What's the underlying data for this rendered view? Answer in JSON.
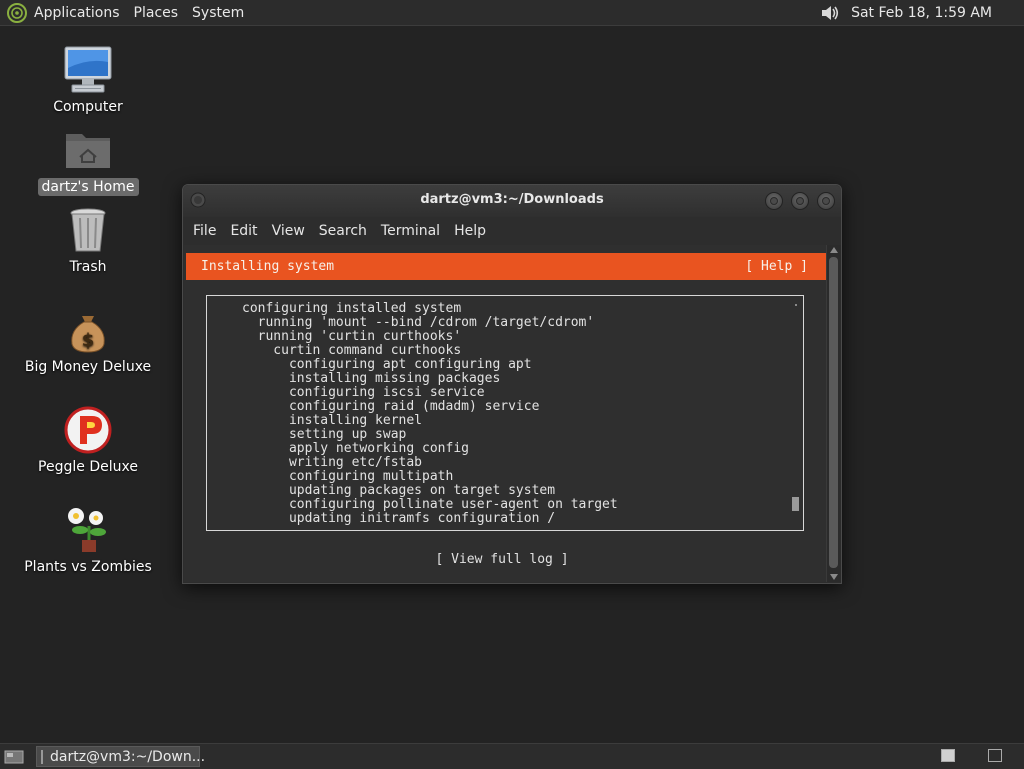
{
  "top_panel": {
    "menus": [
      "Applications",
      "Places",
      "System"
    ],
    "clock": "Sat Feb 18,  1:59 AM",
    "icons": [
      "distro-logo-icon",
      "volume-icon"
    ]
  },
  "desktop": {
    "icons": [
      {
        "label": "Computer",
        "icon": "computer-icon"
      },
      {
        "label": "dartz's Home",
        "icon": "home-folder-icon",
        "selected": true
      },
      {
        "label": "Trash",
        "icon": "trash-icon"
      },
      {
        "label": "Big Money Deluxe",
        "icon": "money-bag-icon"
      },
      {
        "label": "Peggle Deluxe",
        "icon": "peggle-icon"
      },
      {
        "label": "Plants vs Zombies",
        "icon": "plants-vs-zombies-icon"
      }
    ]
  },
  "window": {
    "title": "dartz@vm3:~/Downloads",
    "menu": [
      "File",
      "Edit",
      "View",
      "Search",
      "Terminal",
      "Help"
    ]
  },
  "installer": {
    "header_title": "Installing system",
    "help_label": "[ Help ]",
    "log_lines": [
      "configuring installed system",
      "  running 'mount --bind /cdrom /target/cdrom'",
      "  running 'curtin curthooks'",
      "    curtin command curthooks",
      "      configuring apt configuring apt",
      "      installing missing packages",
      "      configuring iscsi service",
      "      configuring raid (mdadm) service",
      "      installing kernel",
      "      setting up swap",
      "      apply networking config",
      "      writing etc/fstab",
      "      configuring multipath",
      "      updating packages on target system",
      "      configuring pollinate user-agent on target",
      "      updating initramfs configuration /"
    ],
    "view_log_label": "[ View full log ]"
  },
  "bottom_panel": {
    "task_label": "dartz@vm3:~/Down..."
  },
  "colors": {
    "accent": "#e95420",
    "desktop_bg": "#232323",
    "panel_bg": "#2c2c2c"
  }
}
